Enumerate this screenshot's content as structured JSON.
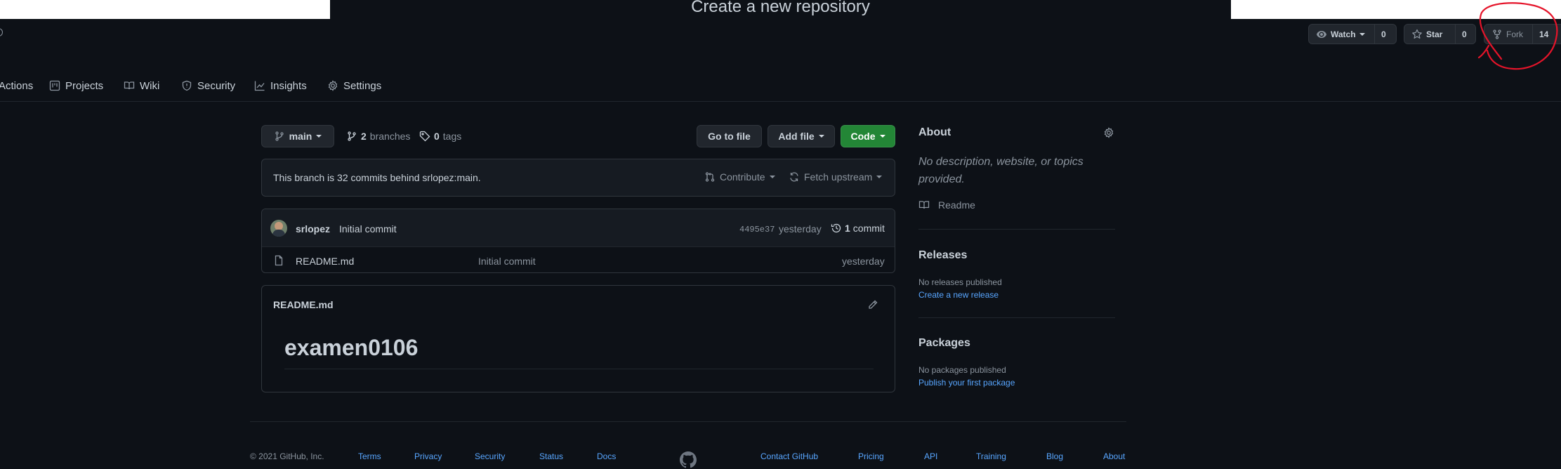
{
  "overlay": {
    "title": "Create a new repository"
  },
  "repo_actions": {
    "watch": {
      "label": "Watch",
      "count": "0"
    },
    "star": {
      "label": "Star",
      "count": "0"
    },
    "fork": {
      "label": "Fork",
      "count": "14"
    }
  },
  "tabs": [
    {
      "label": "Actions",
      "icon": "play-icon"
    },
    {
      "label": "Projects",
      "icon": "project-icon"
    },
    {
      "label": "Wiki",
      "icon": "book-icon"
    },
    {
      "label": "Security",
      "icon": "shield-icon"
    },
    {
      "label": "Insights",
      "icon": "graph-icon"
    },
    {
      "label": "Settings",
      "icon": "gear-icon"
    }
  ],
  "branch_bar": {
    "branch": "main",
    "branches_count": "2",
    "branches_label": "branches",
    "tags_count": "0",
    "tags_label": "tags",
    "go_to_file": "Go to file",
    "add_file": "Add file",
    "code": "Code"
  },
  "behind_bar": {
    "text": "This branch is 32 commits behind srlopez:main.",
    "contribute": "Contribute",
    "fetch_upstream": "Fetch upstream"
  },
  "latest_commit": {
    "author": "srlopez",
    "message": "Initial commit",
    "sha": "4495e37",
    "time": "yesterday",
    "commits_count": "1",
    "commits_label": "commit"
  },
  "files": [
    {
      "name": "README.md",
      "message": "Initial commit",
      "time": "yesterday"
    }
  ],
  "readme": {
    "filename": "README.md",
    "heading": "examen0106"
  },
  "about": {
    "title": "About",
    "description": "No description, website, or topics provided.",
    "readme_label": "Readme"
  },
  "releases": {
    "title": "Releases",
    "empty": "No releases published",
    "link": "Create a new release"
  },
  "packages": {
    "title": "Packages",
    "empty": "No packages published",
    "link": "Publish your first package"
  },
  "footer": {
    "copyright": "© 2021 GitHub, Inc.",
    "links_left": [
      "Terms",
      "Privacy",
      "Security",
      "Status",
      "Docs"
    ],
    "links_right": [
      "Contact GitHub",
      "Pricing",
      "API",
      "Training",
      "Blog",
      "About"
    ]
  },
  "colors": {
    "background": "#0d1117",
    "accent_link": "#58a6ff",
    "button_green": "#238636",
    "annotation_red": "#e5142a"
  }
}
